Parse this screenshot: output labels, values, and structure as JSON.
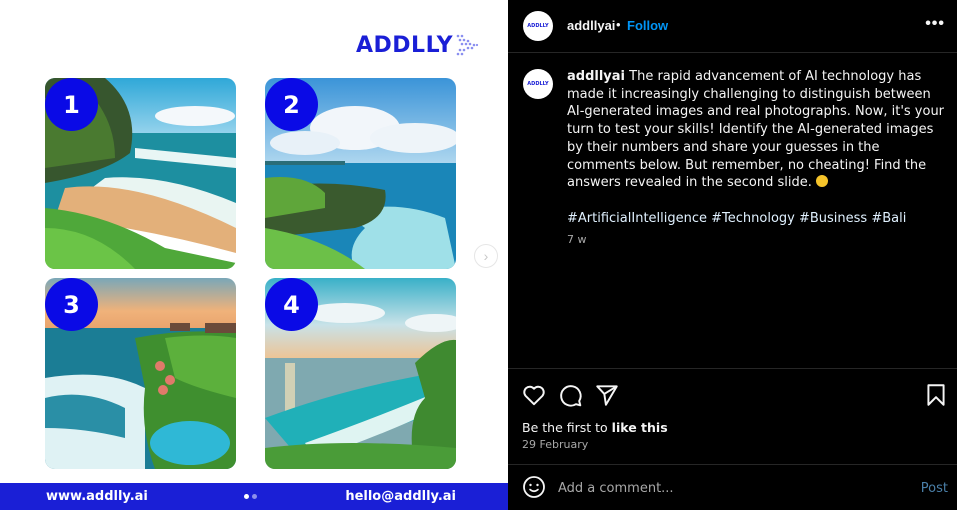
{
  "slide": {
    "brand_name": "ADDLLY",
    "tiles": [
      {
        "number": "1",
        "scene": "beach-cliff"
      },
      {
        "number": "2",
        "scene": "sea-cliff-clouds"
      },
      {
        "number": "3",
        "scene": "cliff-resort-pool-sunset"
      },
      {
        "number": "4",
        "scene": "sunset-coast"
      }
    ],
    "footer_website": "www.addlly.ai",
    "footer_email": "hello@addlly.ai",
    "carousel": {
      "total": 2,
      "current": 1
    },
    "next_icon": "chevron-right-icon",
    "colors": {
      "brand_blue": "#1a1fd6",
      "badge_blue": "#0a0ae6"
    }
  },
  "post": {
    "header": {
      "username": "addllyai",
      "separator": "•",
      "follow_label": "Follow",
      "more_icon": "ellipsis-icon"
    },
    "caption": {
      "username": "addllyai",
      "text": "The rapid advancement of AI technology has made it increasingly challenging to distinguish between AI-generated images and real photographs. Now, it's your turn to test your skills! Identify the AI-generated images by their numbers and share your guesses in the comments below. But remember, no cheating! Find the answers revealed in the second slide.",
      "emoji": "grinning-face",
      "hashtags": "#ArtificialIntelligence #Technology #Business #Bali",
      "age": "7 w"
    },
    "actions": {
      "like_icon": "heart-icon",
      "comment_icon": "comment-icon",
      "share_icon": "paper-plane-icon",
      "save_icon": "bookmark-icon"
    },
    "likes_prefix": "Be the first to ",
    "likes_bold": "like this",
    "date": "29 February",
    "comment_placeholder": "Add a comment...",
    "post_label": "Post",
    "colors": {
      "follow": "#0095f6",
      "post_disabled": "#4a7fa8"
    }
  }
}
